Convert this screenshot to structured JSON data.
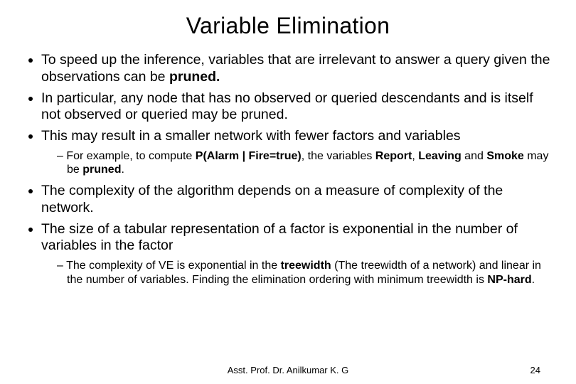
{
  "title": "Variable Elimination",
  "bullets": {
    "b1_a": "To speed up the inference, variables that are irrelevant to answer a query given the observations can be ",
    "b1_b": "pruned.",
    "b2": "In particular, any node that has no observed or queried descendants and is itself not observed or queried may be pruned.",
    "b3": "This may result in a smaller network with fewer factors and variables",
    "s1_a": "For example, to compute ",
    "s1_b": "P(Alarm | Fire=true)",
    "s1_c": ", the variables ",
    "s1_d": "Report",
    "s1_e": ", ",
    "s1_f": "Leaving",
    "s1_g": " and ",
    "s1_h": "Smoke",
    "s1_i": " may be ",
    "s1_j": "pruned",
    "s1_k": ".",
    "b4": "The complexity of the algorithm depends on a measure of complexity of the network.",
    "b5": "The size of a tabular representation of a factor is exponential in the number of variables in the factor",
    "s2_a": "The complexity of VE is exponential in the ",
    "s2_b": "treewidth",
    "s2_c": " (The treewidth of a network) and linear in the number of variables. Finding the elimination ordering with minimum treewidth is ",
    "s2_d": "NP-hard",
    "s2_e": "."
  },
  "footer": {
    "author": "Asst. Prof. Dr. Anilkumar K. G",
    "page": "24"
  }
}
